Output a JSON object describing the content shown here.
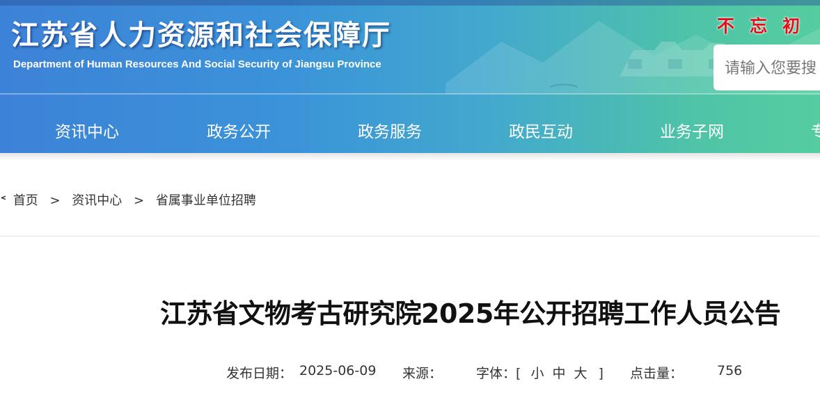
{
  "header": {
    "site_title": "江苏省人力资源和社会保障厅",
    "site_subtitle": "Department of Human Resources And Social Security of Jiangsu Province",
    "slogan": "不忘初",
    "search": {
      "placeholder": "请输入您要搜"
    }
  },
  "nav": {
    "items": [
      {
        "label": "资讯中心"
      },
      {
        "label": "政务公开"
      },
      {
        "label": "政务服务"
      },
      {
        "label": "政民互动"
      },
      {
        "label": "业务子网"
      },
      {
        "label": "专"
      }
    ]
  },
  "breadcrumb": {
    "edge": "<",
    "items": [
      {
        "label": "首页"
      },
      {
        "label": "资讯中心"
      },
      {
        "label": "省属事业单位招聘"
      }
    ],
    "separator": ">"
  },
  "article": {
    "title": "江苏省文物考古研究院2025年公开招聘工作人员公告",
    "meta": {
      "date_label": "发布日期：",
      "date_value": "2025-06-09",
      "source_label": "来源：",
      "source_value": "",
      "font_label": "字体：",
      "font_open": "[",
      "font_small": "小",
      "font_medium": "中",
      "font_large": "大",
      "font_close": "]",
      "clicks_label": "点击量：",
      "clicks_value": "756"
    }
  },
  "colors": {
    "header_start": "#3d82d8",
    "header_end": "#55cda0",
    "slogan": "#e0101a"
  }
}
